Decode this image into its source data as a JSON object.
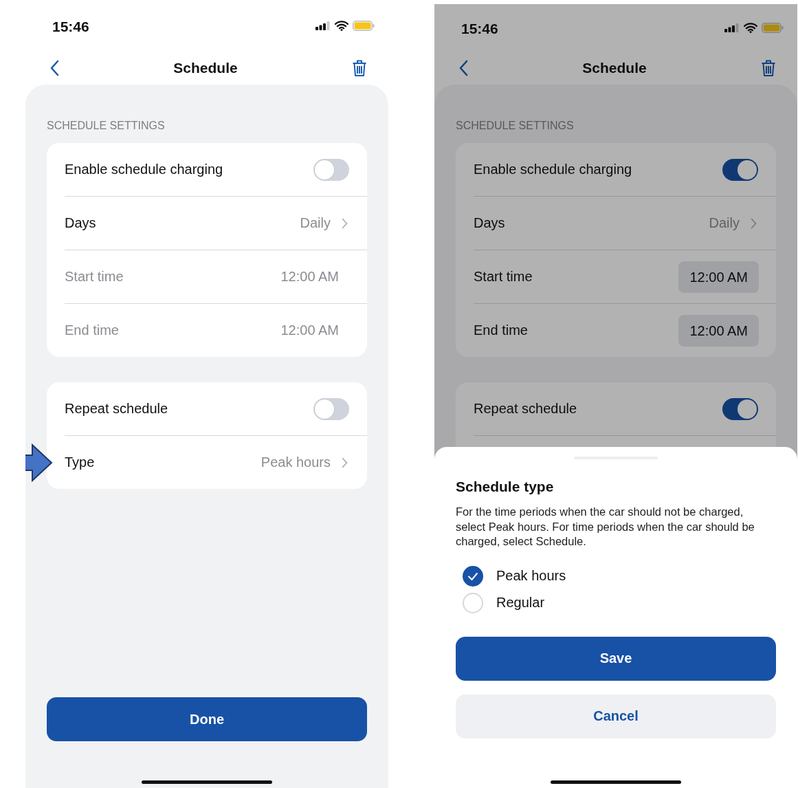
{
  "screens": [
    {
      "status_time": "15:46",
      "title": "Schedule",
      "dimmed": false,
      "section_header": "SCHEDULE SETTINGS",
      "groups": [
        {
          "rows": [
            {
              "kind": "toggle",
              "label": "Enable schedule charging",
              "on": false
            },
            {
              "kind": "link",
              "label": "Days",
              "value": "Daily"
            },
            {
              "kind": "time",
              "label": "Start time",
              "value": "12:00 AM",
              "disabled": true
            },
            {
              "kind": "time",
              "label": "End time",
              "value": "12:00 AM",
              "disabled": true
            }
          ]
        },
        {
          "rows": [
            {
              "kind": "toggle",
              "label": "Repeat schedule",
              "on": false
            },
            {
              "kind": "link",
              "label": "Type",
              "value": "Peak hours",
              "pointed": true
            }
          ]
        }
      ],
      "primary_button": "Done"
    },
    {
      "status_time": "15:46",
      "title": "Schedule",
      "dimmed": true,
      "section_header": "SCHEDULE SETTINGS",
      "groups": [
        {
          "rows": [
            {
              "kind": "toggle",
              "label": "Enable schedule charging",
              "on": true
            },
            {
              "kind": "link",
              "label": "Days",
              "value": "Daily"
            },
            {
              "kind": "time",
              "label": "Start time",
              "value": "12:00 AM",
              "disabled": false
            },
            {
              "kind": "time",
              "label": "End time",
              "value": "12:00 AM",
              "disabled": false
            }
          ]
        },
        {
          "rows": [
            {
              "kind": "toggle",
              "label": "Repeat schedule",
              "on": true
            }
          ]
        }
      ],
      "sheet": {
        "title": "Schedule type",
        "description": "For the time periods when the car should not be charged, select Peak hours. For time periods when the car should be charged, select Schedule.",
        "options": [
          {
            "label": "Peak hours",
            "selected": true
          },
          {
            "label": "Regular",
            "selected": false
          }
        ],
        "save_button": "Save",
        "cancel_button": "Cancel"
      }
    }
  ]
}
